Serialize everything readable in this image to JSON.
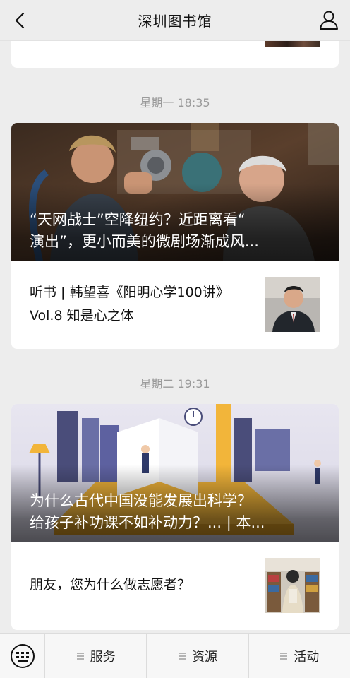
{
  "header": {
    "title": "深圳图书馆",
    "back_icon": "chevron-left-icon",
    "profile_icon": "user-icon"
  },
  "feed": [
    {
      "timestamp": "星期一 18:35",
      "hero_title": "“天网战士”空降纽约？近距离看“\n演出”，更小而美的微剧场渐成风...",
      "sub_items": [
        {
          "title": "听书 | 韩望喜《阳明心学100讲》Vol.8 知是心之体"
        }
      ]
    },
    {
      "timestamp": "星期二 19:31",
      "hero_title": "为什么古代中国没能发展出科学？\n给孩子补功课不如补动力？... | 本...",
      "sub_items": [
        {
          "title": "朋友，您为什么做志愿者？"
        }
      ]
    }
  ],
  "bottom_menu": {
    "keyboard_icon": "keyboard-icon",
    "items": [
      {
        "label": "服务"
      },
      {
        "label": "资源"
      },
      {
        "label": "活动"
      }
    ]
  }
}
